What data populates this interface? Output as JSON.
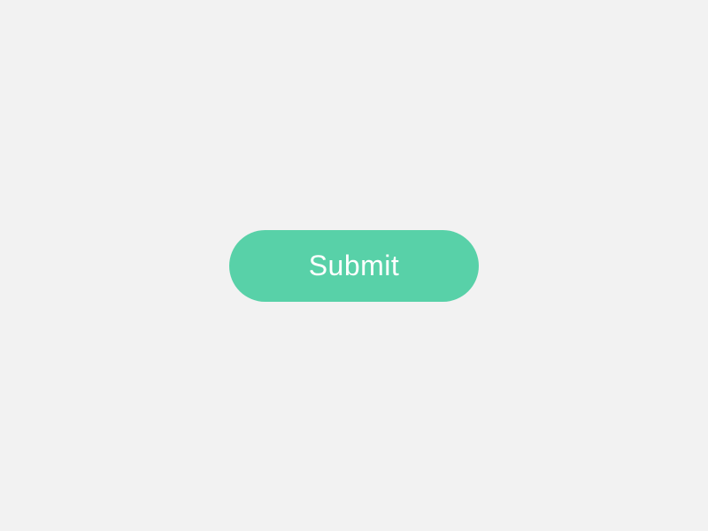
{
  "button": {
    "label": "Submit"
  },
  "colors": {
    "background": "#f2f2f2",
    "button_bg": "#58d1a8",
    "button_text": "#ffffff"
  }
}
